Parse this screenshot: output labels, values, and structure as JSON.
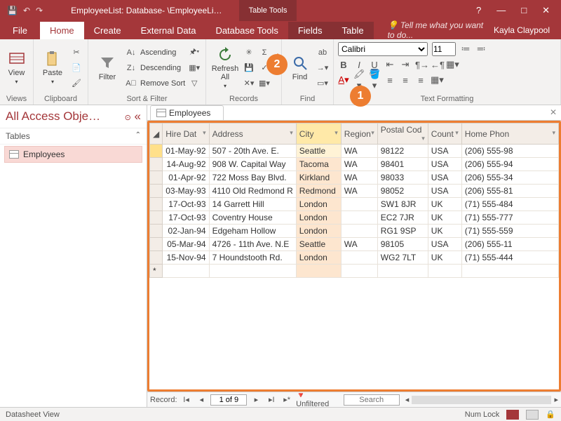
{
  "title": "EmployeeList: Database- \\EmployeeLi…",
  "tools_tab": "Table Tools",
  "user": "Kayla Claypool",
  "tell_me": "Tell me what you want to do...",
  "ribbon_tabs": {
    "file": "File",
    "home": "Home",
    "create": "Create",
    "external": "External Data",
    "dbtools": "Database Tools",
    "fields": "Fields",
    "table": "Table"
  },
  "groups": {
    "views": "Views",
    "clipboard": "Clipboard",
    "sort": "Sort & Filter",
    "records": "Records",
    "find": "Find",
    "text": "Text Formatting"
  },
  "btns": {
    "view": "View",
    "paste": "Paste",
    "filter": "Filter",
    "asc": "Ascending",
    "desc": "Descending",
    "remove": "Remove Sort",
    "refresh": "Refresh\nAll",
    "find": "Find"
  },
  "font": {
    "name": "Calibri",
    "size": "11"
  },
  "nav": {
    "title": "All Access Obje…",
    "group": "Tables",
    "item": "Employees"
  },
  "doc_tab": "Employees",
  "columns": [
    "Hire Dat",
    "Address",
    "City",
    "Region",
    "Postal Cod",
    "Count",
    "Home Phon"
  ],
  "rows": [
    {
      "hire": "01-May-92",
      "addr": "507 - 20th Ave. E.",
      "city": "Seattle",
      "region": "WA",
      "postal": "98122",
      "country": "USA",
      "phone": "(206) 555-98"
    },
    {
      "hire": "14-Aug-92",
      "addr": "908 W. Capital Way",
      "city": "Tacoma",
      "region": "WA",
      "postal": "98401",
      "country": "USA",
      "phone": "(206) 555-94"
    },
    {
      "hire": "01-Apr-92",
      "addr": "722 Moss Bay Blvd.",
      "city": "Kirkland",
      "region": "WA",
      "postal": "98033",
      "country": "USA",
      "phone": "(206) 555-34"
    },
    {
      "hire": "03-May-93",
      "addr": "4110 Old Redmond R",
      "city": "Redmond",
      "region": "WA",
      "postal": "98052",
      "country": "USA",
      "phone": "(206) 555-81"
    },
    {
      "hire": "17-Oct-93",
      "addr": "14 Garrett Hill",
      "city": "London",
      "region": "",
      "postal": "SW1 8JR",
      "country": "UK",
      "phone": "(71) 555-484"
    },
    {
      "hire": "17-Oct-93",
      "addr": "Coventry House",
      "city": "London",
      "region": "",
      "postal": "EC2 7JR",
      "country": "UK",
      "phone": "(71) 555-777"
    },
    {
      "hire": "02-Jan-94",
      "addr": "Edgeham Hollow",
      "city": "London",
      "region": "",
      "postal": "RG1 9SP",
      "country": "UK",
      "phone": "(71) 555-559"
    },
    {
      "hire": "05-Mar-94",
      "addr": "4726 - 11th Ave. N.E",
      "city": "Seattle",
      "region": "WA",
      "postal": "98105",
      "country": "USA",
      "phone": "(206) 555-11"
    },
    {
      "hire": "15-Nov-94",
      "addr": "7 Houndstooth Rd.",
      "city": "London",
      "region": "",
      "postal": "WG2 7LT",
      "country": "UK",
      "phone": "(71) 555-444"
    }
  ],
  "recnav": {
    "label": "Record:",
    "pos": "1 of 9",
    "filter": "Unfiltered",
    "search": "Search"
  },
  "status": {
    "left": "Datasheet View",
    "numlock": "Num Lock"
  },
  "callouts": {
    "c1": "1",
    "c2": "2"
  }
}
